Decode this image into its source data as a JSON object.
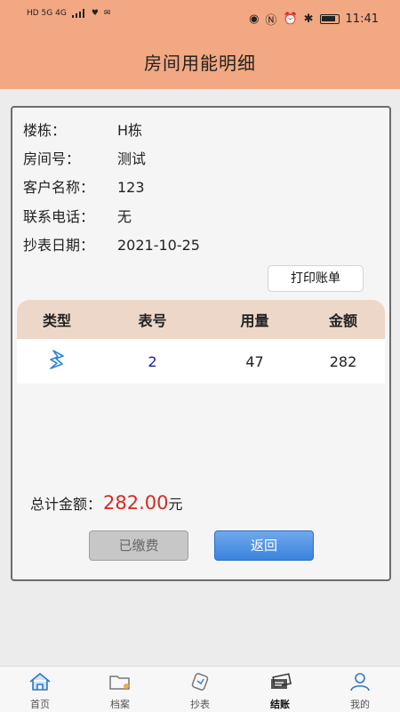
{
  "status_bar": {
    "left_text": "HD 5G 4G",
    "time": "11:41"
  },
  "header": {
    "title": "房间用能明细"
  },
  "info": [
    {
      "label": "楼栋：",
      "value": "H栋"
    },
    {
      "label": "房间号：",
      "value": "测试"
    },
    {
      "label": "客户名称：",
      "value": "123"
    },
    {
      "label": "联系电话：",
      "value": "无"
    },
    {
      "label": "抄表日期：",
      "value": "2021-10-25"
    }
  ],
  "print_button": "打印账单",
  "table": {
    "headers": [
      "类型",
      "表号",
      "用量",
      "金额"
    ],
    "rows": [
      {
        "type_icon": "electricity-bolt-icon",
        "meter_no": "2",
        "usage": "47",
        "amount": "282"
      }
    ]
  },
  "total": {
    "label": "总计金额：",
    "amount": "282.00",
    "unit": "元"
  },
  "buttons": {
    "paid": "已缴费",
    "back": "返回"
  },
  "tabs": [
    {
      "label": "首页",
      "icon": "home-icon"
    },
    {
      "label": "档案",
      "icon": "folder-icon"
    },
    {
      "label": "抄表",
      "icon": "meter-read-icon"
    },
    {
      "label": "结账",
      "icon": "checkout-icon",
      "active": true
    },
    {
      "label": "我的",
      "icon": "user-icon"
    }
  ],
  "colors": {
    "header": "#f2a882",
    "accent": "#3b83dd",
    "amount": "#d62a22",
    "table_header": "#ecd7c9"
  }
}
